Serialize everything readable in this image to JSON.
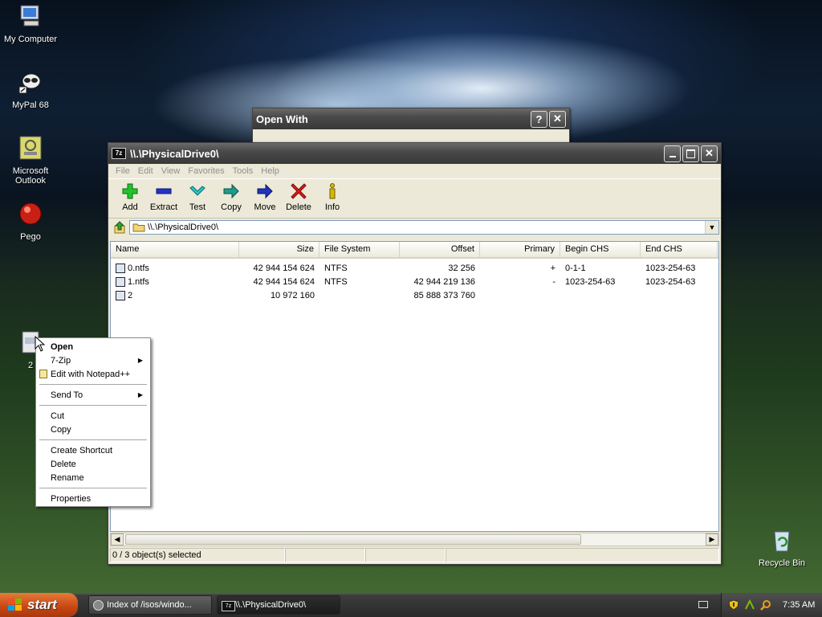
{
  "desktop": {
    "icons": [
      {
        "label": "My Computer"
      },
      {
        "label": "MyPal 68"
      },
      {
        "label": "Microsoft Outlook"
      },
      {
        "label": "Pego"
      },
      {
        "label": "2"
      },
      {
        "label": "Recycle Bin"
      }
    ]
  },
  "open_with": {
    "title": "Open With",
    "help_label": "?",
    "close_label": "✕"
  },
  "main_window": {
    "title": "\\\\.\\PhysicalDrive0\\",
    "menu": [
      "File",
      "Edit",
      "View",
      "Favorites",
      "Tools",
      "Help"
    ],
    "toolbar": [
      {
        "label": "Add",
        "icon": "plus-icon"
      },
      {
        "label": "Extract",
        "icon": "minus-icon"
      },
      {
        "label": "Test",
        "icon": "check-icon"
      },
      {
        "label": "Copy",
        "icon": "arrow-right-icon"
      },
      {
        "label": "Move",
        "icon": "arrow-right-icon"
      },
      {
        "label": "Delete",
        "icon": "x-icon"
      },
      {
        "label": "Info",
        "icon": "info-icon"
      }
    ],
    "address": "\\\\.\\PhysicalDrive0\\",
    "columns": [
      "Name",
      "Size",
      "File System",
      "Offset",
      "Primary",
      "Begin CHS",
      "End CHS"
    ],
    "rows": [
      {
        "name": "0.ntfs",
        "size": "42 944 154 624",
        "fs": "NTFS",
        "offset": "32 256",
        "primary": "+",
        "begin": "0-1-1",
        "end": "1023-254-63"
      },
      {
        "name": "1.ntfs",
        "size": "42 944 154 624",
        "fs": "NTFS",
        "offset": "42 944 219 136",
        "primary": "-",
        "begin": "1023-254-63",
        "end": "1023-254-63"
      },
      {
        "name": "2",
        "size": "10 972 160",
        "fs": "",
        "offset": "85 888 373 760",
        "primary": "",
        "begin": "",
        "end": ""
      }
    ],
    "status": "0 / 3 object(s) selected"
  },
  "context_menu": {
    "items": [
      "Open",
      "7-Zip",
      "Edit with Notepad++",
      "Send To",
      "Cut",
      "Copy",
      "Create Shortcut",
      "Delete",
      "Rename",
      "Properties"
    ]
  },
  "taskbar": {
    "start_label": "start",
    "tasks": [
      "Index of /isos/windo...",
      "\\\\.\\PhysicalDrive0\\"
    ],
    "clock": "7:35 AM"
  }
}
